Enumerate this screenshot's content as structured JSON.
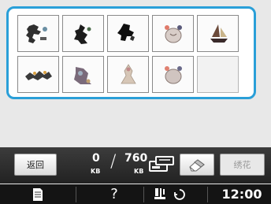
{
  "panel": {
    "thumbnails": [
      {
        "name": "design-1",
        "color": "#2f2f2f",
        "accent": "#6a8fa3"
      },
      {
        "name": "design-2",
        "color": "#1c1c1c",
        "accent": "#4a6b4a"
      },
      {
        "name": "design-3",
        "color": "#0f0f0f",
        "accent": "#303030"
      },
      {
        "name": "design-4",
        "color": "#b9a9a4",
        "accent": "#e07a6a"
      },
      {
        "name": "design-5",
        "color": "#6b4a3a",
        "accent": "#c9b48a"
      },
      {
        "name": "design-6",
        "color": "#3a3a3a",
        "accent": "#d9a040"
      },
      {
        "name": "design-7",
        "color": "#7a6a7a",
        "accent": "#9fb0c0"
      },
      {
        "name": "design-8",
        "color": "#d6c6b6",
        "accent": "#c08a8a"
      },
      {
        "name": "design-9",
        "color": "#b0a0a0",
        "accent": "#e08070"
      }
    ]
  },
  "infobar": {
    "return_label": "返回",
    "memory_used": "0",
    "memory_used_unit": "KB",
    "memory_total": "760",
    "memory_total_unit": "KB",
    "embroidery_label": "绣花"
  },
  "bottombar": {
    "time": "12:00",
    "help_label": "?"
  },
  "colors": {
    "accent": "#2a9fd8",
    "infobar_bg": "#2a2a2a",
    "bottombar_bg": "#141414"
  }
}
